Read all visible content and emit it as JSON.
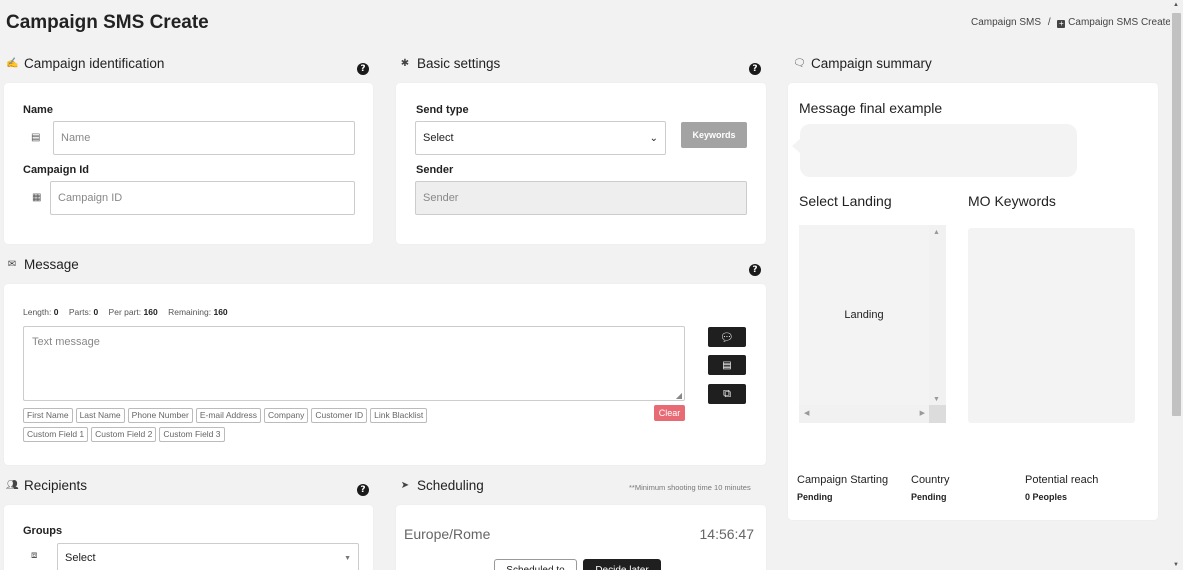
{
  "page": {
    "title": "Campaign SMS Create",
    "breadcrumb": {
      "parent": "Campaign SMS",
      "separator": "/",
      "current": "Campaign SMS Create",
      "current_icon": "plus-square-icon"
    }
  },
  "identification": {
    "title": "Campaign identification",
    "icon": "signature-icon",
    "name_label": "Name",
    "name_placeholder": "Name",
    "campaign_id_label": "Campaign Id",
    "campaign_id_placeholder": "Campaign ID"
  },
  "basic": {
    "title": "Basic settings",
    "icon": "gear-icon",
    "send_type_label": "Send type",
    "send_type_value": "Select",
    "keywords_button": "Keywords",
    "sender_label": "Sender",
    "sender_placeholder": "Sender"
  },
  "summary": {
    "title": "Campaign summary",
    "icon": "chat-bubbles-icon",
    "message_final": "Message final example",
    "select_landing": "Select Landing",
    "landing": "Landing",
    "mo_keywords": "MO Keywords",
    "campaign_starting_label": "Campaign Starting",
    "campaign_starting_value": "Pending",
    "country_label": "Country",
    "country_value": "Pending",
    "potential_reach_label": "Potential reach",
    "potential_reach_value": "0 Peoples"
  },
  "message": {
    "title": "Message",
    "icon": "envelope-icon",
    "length_label": "Length:",
    "length_value": "0",
    "parts_label": "Parts:",
    "parts_value": "0",
    "per_part_label": "Per part:",
    "per_part_value": "160",
    "remaining_label": "Remaining:",
    "remaining_value": "160",
    "placeholder": "Text message",
    "tags_row1": [
      "First Name",
      "Last Name",
      "Phone Number",
      "E-mail Address",
      "Company",
      "Customer ID",
      "Link Blacklist"
    ],
    "tags_row2": [
      "Custom Field 1",
      "Custom Field 2",
      "Custom Field 3"
    ],
    "clear_button": "Clear",
    "accent_red": "#e86a74"
  },
  "recipients": {
    "title": "Recipients",
    "icon": "users-icon",
    "groups_label": "Groups",
    "groups_value": "Select"
  },
  "scheduling": {
    "title": "Scheduling",
    "icon": "paper-plane-icon",
    "note": "**Minimum shooting time 10 minutes",
    "timezone": "Europe/Rome",
    "time": "14:56:47",
    "scheduled_button": "Scheduled to",
    "decide_button": "Decide later"
  }
}
